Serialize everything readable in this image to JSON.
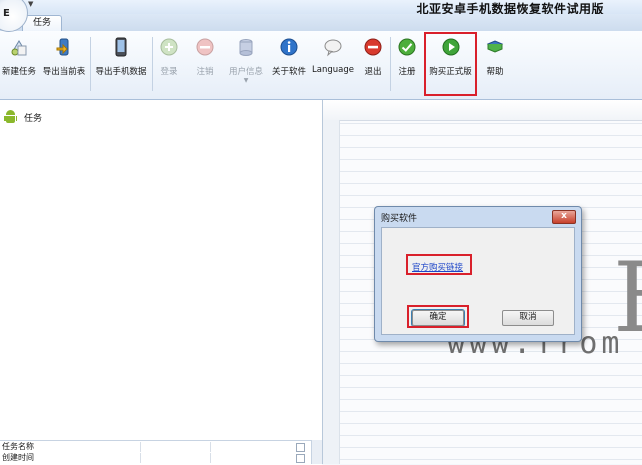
{
  "app": {
    "orb_label": "E",
    "title": "北亚安卓手机数据恢复软件试用版"
  },
  "tabs": [
    {
      "label": "任务",
      "active": true
    }
  ],
  "ribbon": {
    "buttons": [
      {
        "label": "新建任务",
        "icon": "new-task-icon",
        "enabled": true
      },
      {
        "label": "导出当前表",
        "icon": "export-table-icon",
        "enabled": true
      },
      {
        "label": "导出手机数据",
        "icon": "export-phone-icon",
        "enabled": true
      },
      {
        "label": "登录",
        "icon": "login-icon",
        "enabled": false
      },
      {
        "label": "注销",
        "icon": "logout-icon",
        "enabled": false
      },
      {
        "label": "用户信息",
        "icon": "user-info-icon",
        "enabled": false
      },
      {
        "label": "关于软件",
        "icon": "about-icon",
        "enabled": true
      },
      {
        "label": "Language",
        "icon": "language-icon",
        "enabled": true
      },
      {
        "label": "退出",
        "icon": "exit-icon",
        "enabled": true
      },
      {
        "label": "注册",
        "icon": "register-icon",
        "enabled": true
      },
      {
        "label": "购买正式版",
        "icon": "buy-icon",
        "enabled": true,
        "highlighted": true
      },
      {
        "label": "帮助",
        "icon": "help-icon",
        "enabled": true
      }
    ]
  },
  "left_panel": {
    "tree_root": "任务",
    "properties": [
      {
        "key": "任务名称"
      },
      {
        "key": "创建时间"
      }
    ]
  },
  "right_panel": {
    "watermark_letter": "E",
    "watermark_url": "www.from"
  },
  "dialog": {
    "title": "购买软件",
    "close_symbol": "x",
    "link_text": "官方购买链接",
    "ok_label": "确定",
    "cancel_label": "取消"
  },
  "colors": {
    "highlight_red": "#d9202b",
    "ribbon_bg": "#e6eef8",
    "android_green": "#8bb82c",
    "link_blue": "#1e46c8"
  }
}
